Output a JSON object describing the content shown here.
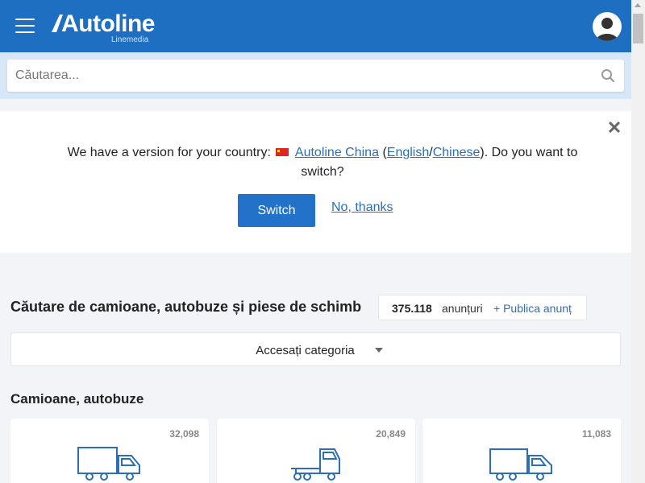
{
  "header": {
    "logo_text": "Autoline",
    "logo_sub": "Linemedia",
    "menu_icon": "hamburger-menu-icon",
    "avatar_icon": "user-avatar-icon"
  },
  "search": {
    "placeholder": "Căutarea...",
    "value": "",
    "icon": "search-icon"
  },
  "banner": {
    "text_before": "We have a version for your country:",
    "site_link": "Autoline China",
    "paren_open": "(",
    "lang1": "English",
    "slash": "/",
    "lang2": "Chinese",
    "text_after": "). Do you want to switch?",
    "switch_label": "Switch",
    "no_thanks_label": "No, thanks",
    "flag_icon": "china-flag-icon",
    "close_icon": "close-icon"
  },
  "main": {
    "title": "Căutare de camioane, autobuze și piese de schimb",
    "count": "375.118",
    "count_word": "anunțuri",
    "publish_label": "+ Publica anunț",
    "category_label": "Accesați categoria",
    "subsection_title": "Camioane, autobuze",
    "cards": [
      {
        "count": "32,098",
        "icon": "box-truck-icon"
      },
      {
        "count": "20,849",
        "icon": "tractor-unit-icon"
      },
      {
        "count": "11,083",
        "icon": "van-icon"
      }
    ]
  },
  "colors": {
    "header_bg": "#1e6fc2",
    "accent": "#2272c9",
    "link": "#2a6fb8"
  }
}
